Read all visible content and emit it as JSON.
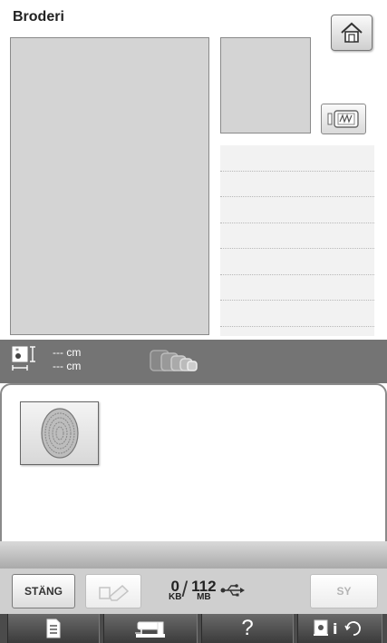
{
  "header": {
    "title": "Broderi"
  },
  "size_display": {
    "height_value": "--- cm",
    "width_value": "--- cm"
  },
  "controls": {
    "close_label": "STÄNG",
    "sew_label": "SY"
  },
  "memory": {
    "used_value": "0",
    "used_unit": "KB",
    "total_value": "112",
    "total_unit": "MB",
    "separator": "/"
  },
  "bottom_nav": {
    "help_label": "?"
  },
  "colors": {
    "preview_bg": "#d4d4d4",
    "bar_gray": "#747474",
    "nav_dark": "#4b4b4b"
  }
}
